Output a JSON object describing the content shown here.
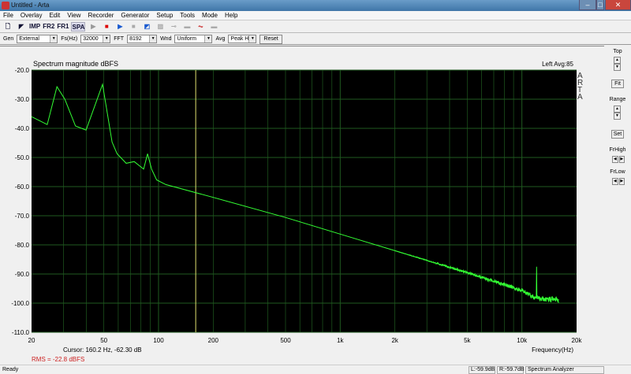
{
  "window": {
    "title": "Untitled - Arta"
  },
  "menu": [
    "File",
    "Overlay",
    "Edit",
    "View",
    "Recorder",
    "Generator",
    "Setup",
    "Tools",
    "Mode",
    "Help"
  ],
  "toolbar": [
    "new-icon",
    "open-icon",
    "IMP",
    "FR2",
    "FR1",
    "SPA",
    "play-icon",
    "stop-icon",
    "run-icon",
    "pause-icon",
    "rec-icon",
    "grid-icon",
    "link-icon",
    "bar-icon",
    "scope-icon",
    "window-icon"
  ],
  "options": {
    "gen_label": "Gen",
    "gen_value": "External",
    "fs_label": "Fs(Hz)",
    "fs_value": "32000",
    "fft_label": "FFT",
    "fft_value": "8192",
    "wnd_label": "Wnd",
    "wnd_value": "Uniform",
    "avg_label": "Avg",
    "avg_value": "Peak Ho",
    "reset": "Reset"
  },
  "plot": {
    "title": "Spectrum magnitude dBFS",
    "channel": "Left  Avg:85",
    "side_logo": "ARTA",
    "cursor": "Cursor:   160.2 Hz, -62.30 dB",
    "rms": "RMS =  -22.8 dBFS",
    "xlabel": "Frequency(Hz)"
  },
  "right_panel": {
    "top": "Top",
    "fit": "Fit",
    "range": "Range",
    "set": "Set",
    "frhigh": "FrHigh",
    "frlow": "FrLow"
  },
  "status": {
    "ready": "Ready",
    "left": "L:-59.9dB",
    "right": "R:-59.7dB",
    "mode": "Spectrum Analyzer"
  },
  "colors": {
    "trace": "#33ff33",
    "grid": "#1f5a1f",
    "cursor": "#e0e070",
    "rms": "#cc2222"
  },
  "chart_data": {
    "type": "line",
    "title": "Spectrum magnitude dBFS",
    "xlabel": "Frequency(Hz)",
    "ylabel": "dBFS",
    "xscale": "log",
    "xlim": [
      20,
      20000
    ],
    "ylim": [
      -110,
      -20
    ],
    "xticks": [
      20,
      50,
      100,
      200,
      500,
      1000,
      2000,
      5000,
      10000,
      20000
    ],
    "xtick_labels": [
      "20",
      "50",
      "100",
      "200",
      "500",
      "1k",
      "2k",
      "5k",
      "10k",
      "20k"
    ],
    "yticks": [
      -20,
      -30,
      -40,
      -50,
      -60,
      -70,
      -80,
      -90,
      -100,
      -110
    ],
    "ytick_labels": [
      "-20.0",
      "-30.0",
      "-40.0",
      "-50.0",
      "-60.0",
      "-70.0",
      "-80.0",
      "-90.0",
      "-100.0",
      "-110.0"
    ],
    "cursor_hz": 160.2,
    "series": [
      {
        "name": "Left",
        "x": [
          20,
          24.4,
          27.6,
          30.5,
          34.9,
          39.9,
          49.2,
          55.5,
          59.1,
          66.4,
          73.4,
          82.8,
          87,
          91.6,
          97.6,
          109.6,
          200,
          500,
          1000,
          2000,
          5000,
          10000,
          12000,
          12050,
          12100,
          16000
        ],
        "y": [
          -36,
          -38.7,
          -25.7,
          -30,
          -39.2,
          -40.6,
          -24.9,
          -44.7,
          -48.7,
          -52,
          -51.4,
          -54,
          -48.7,
          -54,
          -57.7,
          -59.3,
          -63.7,
          -70.6,
          -76.3,
          -82,
          -89.5,
          -95.7,
          -98.3,
          -87.5,
          -98.3,
          -98.9
        ]
      }
    ]
  }
}
